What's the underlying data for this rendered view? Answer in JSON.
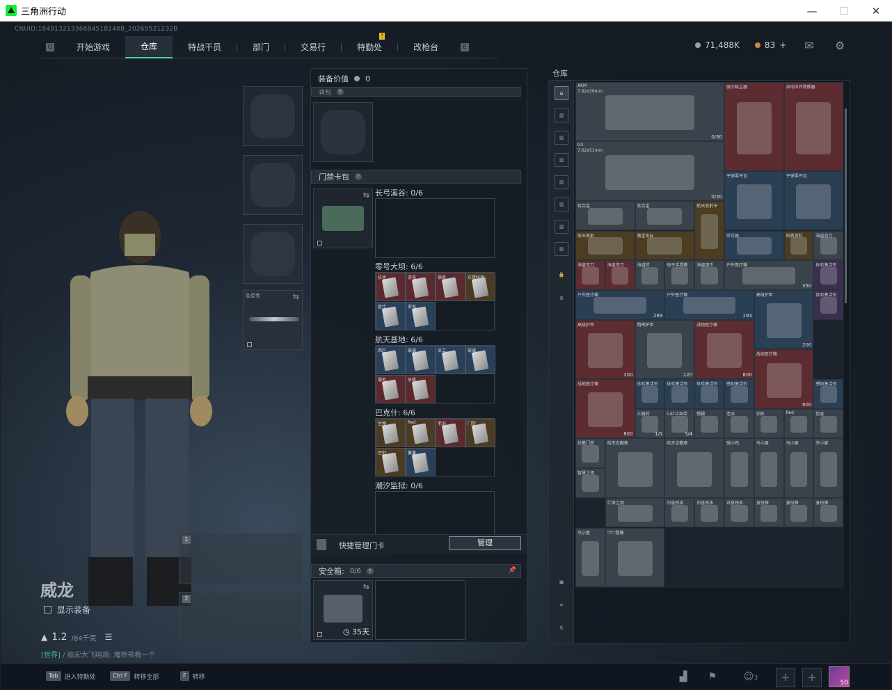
{
  "window": {
    "title": "三角洲行动",
    "min": "—",
    "max": "☐",
    "close": "✕"
  },
  "uid": "CNUID:18491321336684518248B_20260521232B",
  "nav": {
    "tabs": [
      "开始游戏",
      "仓库",
      "特战干员",
      "部门",
      "交易行",
      "特勤处",
      "改枪台"
    ],
    "active": "仓库",
    "left_key": "Q",
    "right_key": "E",
    "badge": "!"
  },
  "currency": {
    "silver": "71,488K",
    "gold": "83",
    "plus": "+"
  },
  "equip_slots": {
    "melee_label": "坠星者"
  },
  "character": {
    "name": "威龙",
    "show_equipment": "显示装备",
    "weight": "1.2",
    "weight_max": "/84千克"
  },
  "chat": {
    "channel": "[世界]",
    "text": "/ 船宏大飞翔湖: 堵桥带我一个"
  },
  "weapon_slots": [
    "1",
    "2"
  ],
  "middle": {
    "equip_value_label": "装备价值",
    "equip_value": "0",
    "backpack_label": "背包",
    "keycard_label": "门禁卡包",
    "sections": [
      {
        "name": "长弓溪谷: 0/6"
      },
      {
        "name": "零号大坝: 6/6",
        "cards": [
          "技术",
          "变电",
          "宿舍",
          "东楼经理",
          "医疗",
          "变电"
        ]
      },
      {
        "name": "航天基地: 6/6",
        "cards": [
          "西区",
          "玻璃",
          "员工",
          "玻璃",
          "服务",
          "总裁"
        ]
      },
      {
        "name": "巴克什: 6/6",
        "cards": [
          "生物",
          "Red",
          "老旧",
          "门禁",
          "巴别",
          "蔓蔓"
        ]
      },
      {
        "name": "潮汐监狱: 0/6"
      }
    ],
    "quick_manage": "快捷管理门卡",
    "manage_btn": "管理",
    "safebox_label": "安全箱:",
    "safebox_count": "0/6",
    "safebox_days": "35天"
  },
  "warehouse": {
    "title": "仓库",
    "items": [
      {
        "label": "AKM",
        "sub": "7.62x39mm",
        "count": "0/30"
      },
      {
        "label": "强力吸尘器",
        "count": ""
      },
      {
        "label": "自动体外除颤器",
        "count": ""
      },
      {
        "label": "G3",
        "sub": "7.62x51mm",
        "count": "0/20"
      },
      {
        "label": "子弹零件包",
        "count": ""
      },
      {
        "label": "子弹零件包",
        "count": ""
      },
      {
        "label": "钛合金",
        "count": ""
      },
      {
        "label": "钛合金",
        "count": ""
      },
      {
        "label": "航天发射卡",
        "count": ""
      },
      {
        "label": "航天发射",
        "count": ""
      },
      {
        "label": "黄金车标",
        "count": ""
      },
      {
        "label": "听诊器",
        "count": ""
      },
      {
        "label": "纸质资料",
        "count": ""
      },
      {
        "label": "海盗弯刀",
        "count": ""
      },
      {
        "label": "海盗弯刀",
        "count": ""
      },
      {
        "label": "海盗弯刀",
        "count": ""
      },
      {
        "label": "海盗斧",
        "count": ""
      },
      {
        "label": "电子手提箱",
        "count": ""
      },
      {
        "label": "海盗银币",
        "count": ""
      },
      {
        "label": "户外医疗箱",
        "count": "350"
      },
      {
        "label": "体验激活剂",
        "count": ""
      },
      {
        "label": "户外医疗箱",
        "count": "289"
      },
      {
        "label": "户外医疗箱",
        "count": "193"
      },
      {
        "label": "高级护甲",
        "count": "200"
      },
      {
        "label": "体验激活剂",
        "count": ""
      },
      {
        "label": "高级护甲",
        "count": "200"
      },
      {
        "label": "精密护甲",
        "count": "120"
      },
      {
        "label": "战地医疗箱",
        "count": "800"
      },
      {
        "label": "战地医疗箱",
        "count": "800"
      },
      {
        "label": "战地医疗箱",
        "count": "800"
      },
      {
        "label": "体验激活剂",
        "count": ""
      },
      {
        "label": "体验激活剂",
        "count": ""
      },
      {
        "label": "体验激活剂",
        "count": ""
      },
      {
        "label": "感知激活剂",
        "count": ""
      },
      {
        "label": "感知激活剂",
        "count": ""
      },
      {
        "label": "止痛药",
        "count": "1/1"
      },
      {
        "label": "CAT止血带",
        "count": "3/4"
      },
      {
        "label": "情报",
        "count": ""
      },
      {
        "label": "老旧",
        "count": ""
      },
      {
        "label": "训练",
        "count": ""
      },
      {
        "label": "Red",
        "count": ""
      },
      {
        "label": "信息",
        "count": ""
      },
      {
        "label": "坊墨门禁",
        "count": ""
      },
      {
        "label": "哈夫克徽章",
        "count": ""
      },
      {
        "label": "哈夫克徽章",
        "count": ""
      },
      {
        "label": "骑小鸡",
        "count": ""
      },
      {
        "label": "乌小屋",
        "count": ""
      },
      {
        "label": "乌小屋",
        "count": ""
      },
      {
        "label": "乔小屋",
        "count": ""
      },
      {
        "label": "智慧之钥",
        "count": ""
      },
      {
        "label": "仁恒之钥",
        "count": ""
      },
      {
        "label": "讯息残本",
        "count": ""
      },
      {
        "label": "讯息残本",
        "count": ""
      },
      {
        "label": "讯息残本",
        "count": ""
      },
      {
        "label": "身份牌",
        "count": ""
      },
      {
        "label": "身份牌",
        "count": ""
      },
      {
        "label": "身份牌",
        "count": ""
      },
      {
        "label": "乌小屋",
        "count": ""
      },
      {
        "label": "\"六\"壁爆",
        "count": ""
      }
    ]
  },
  "bottombar": {
    "hotkeys": [
      {
        "key": "Tab",
        "label": "进入特勤处"
      },
      {
        "key": "Ctrl F",
        "label": "转移全部"
      },
      {
        "key": "F",
        "label": "转移"
      }
    ],
    "friends_count": "3",
    "avatar_level": "50"
  }
}
